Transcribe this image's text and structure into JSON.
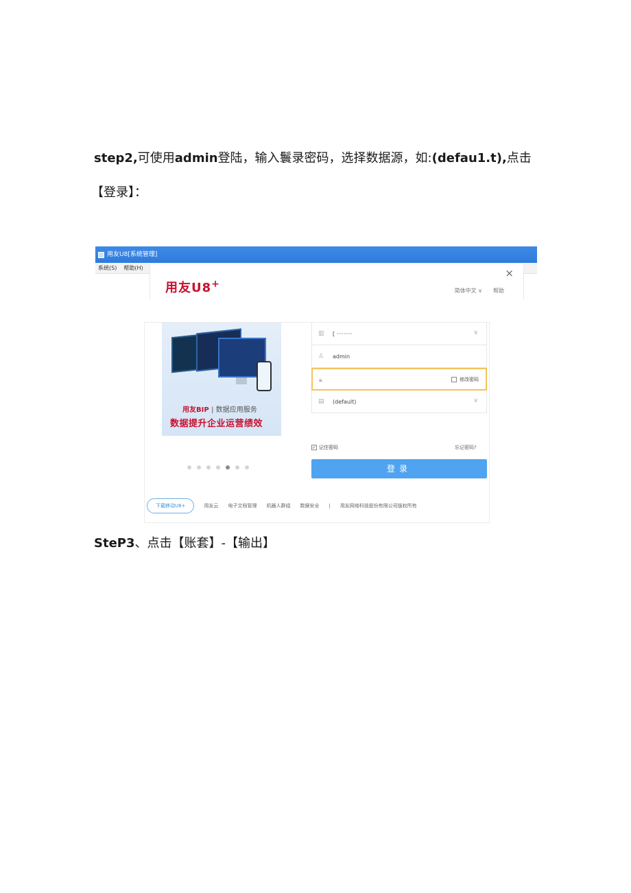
{
  "doc": {
    "line1_a": "step2,",
    "line1_b": "可使用",
    "line1_c": "admin",
    "line1_d": "登陆，输入鬟录密码，选择数据源，如:",
    "line1_e": "(defau1.t),",
    "line1_f": "点击",
    "line2": "【登录】：",
    "line3_a": "SteP3",
    "line3_b": "、点击【账套】-【输出】"
  },
  "window": {
    "title": "用友U8[系统管理]",
    "menu": [
      "系统(S)",
      "帮助(H)"
    ]
  },
  "login": {
    "brand": "用友U8",
    "brand_sup": "+",
    "close": "×",
    "language": "简体中文 ∨",
    "help": "帮助",
    "banner_brand": "用友BIP",
    "banner_sub": "| 数据应用服务",
    "banner_main": "数据提升企业运营绩效",
    "server_value": "[ ·········",
    "user_value": "admin",
    "password_value": "",
    "change_password": "修改密码",
    "datasource_value": "(default)",
    "remember_password": "记住密码",
    "forgot_password": "忘记密码?",
    "login_button": "登录",
    "carousel_count": 7,
    "carousel_active": 5
  },
  "footer": {
    "download": "下载移动U8+",
    "links": [
      "用友云",
      "电子文档管理",
      "机器人群组",
      "数据安全",
      "|",
      "用友网络科技股份有限公司版权所有"
    ]
  },
  "icons": [
    "server-icon",
    "user-icon",
    "lock-icon",
    "database-icon",
    "close-icon",
    "chevron-down-icon"
  ]
}
